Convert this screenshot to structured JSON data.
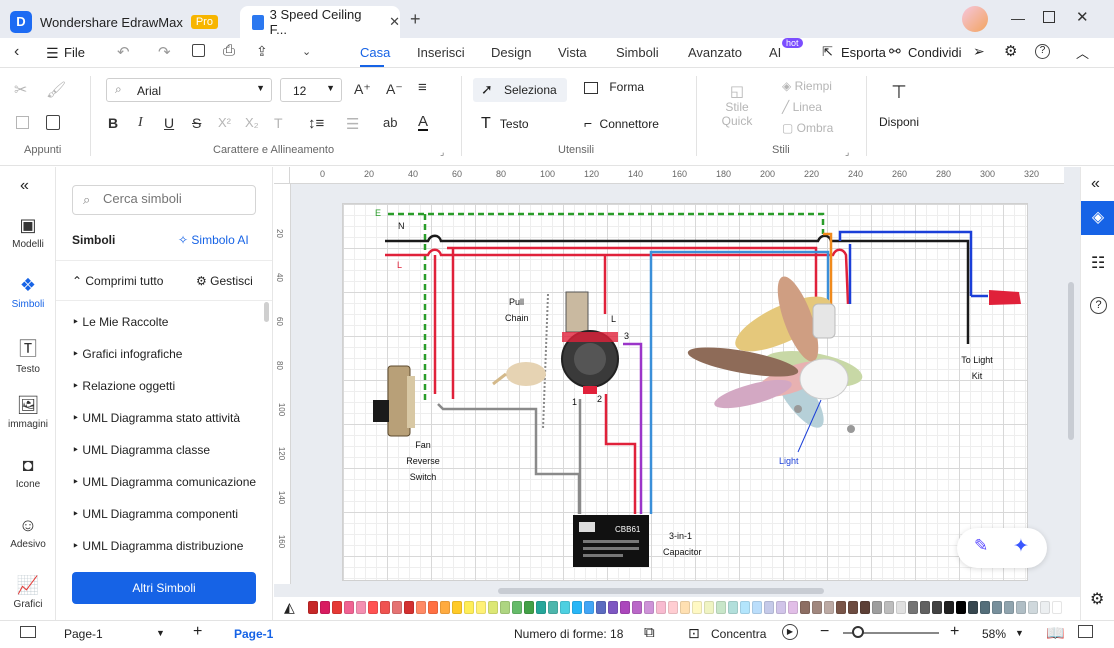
{
  "app": {
    "name": "Wondershare EdrawMax",
    "badge": "Pro",
    "doc_tab": "3 Speed Ceiling F..."
  },
  "menu": {
    "file": "File",
    "tabs": [
      "Casa",
      "Inserisci",
      "Design",
      "Vista",
      "Simboli",
      "Avanzato",
      "AI"
    ],
    "ai_badge": "hot",
    "export": "Esporta",
    "share": "Condividi"
  },
  "ribbon": {
    "font_name": "Arial",
    "font_size": "12",
    "select": "Seleziona",
    "shape": "Forma",
    "text": "Testo",
    "connector": "Connettore",
    "quick_style_1": "Stile",
    "quick_style_2": "Quick",
    "fill": "Riempi",
    "line": "Linea",
    "shadow": "Ombra",
    "arrange": "Disponi",
    "groups": [
      "Appunti",
      "Carattere e Allineamento",
      "Utensili",
      "Stili"
    ]
  },
  "rail": [
    "Modelli",
    "Simboli",
    "Testo",
    "immagini",
    "Icone",
    "Adesivo",
    "Grafici"
  ],
  "panel": {
    "search_placeholder": "Cerca simboli",
    "title": "Simboli",
    "ai_link": "Simbolo AI",
    "collapse": "Comprimi tutto",
    "manage": "Gestisci",
    "libraries": [
      "Le Mie Raccolte",
      "Grafici infografiche",
      "Relazione oggetti",
      "UML Diagramma stato attività",
      "UML Diagramma classe",
      "UML Diagramma comunicazione",
      "UML Diagramma componenti",
      "UML Diagramma distribuzione"
    ],
    "more_button": "Altri Simboli"
  },
  "ruler": {
    "h": [
      "0",
      "20",
      "40",
      "60",
      "80",
      "100",
      "120",
      "140",
      "160",
      "180",
      "200",
      "220",
      "240",
      "260",
      "280",
      "300",
      "320"
    ],
    "v": [
      "20",
      "40",
      "60",
      "80",
      "100",
      "120",
      "140",
      "160"
    ]
  },
  "diagram": {
    "labels": {
      "e": "E",
      "n": "N",
      "l": "L",
      "pull_1": "Pull",
      "pull_2": "Chain",
      "sw_l": "L",
      "sw_3": "3",
      "sw_1": "1",
      "sw_2": "2",
      "fan_1": "Fan",
      "fan_2": "Reverse",
      "fan_3": "Switch",
      "cap_1": "3-in-1",
      "cap_2": "Capacitor",
      "cap_brand": "CBB61",
      "light": "Light",
      "kit_1": "To Light",
      "kit_2": "Kit"
    },
    "colors": {
      "black": "#1a1a1a",
      "red": "#e0213a",
      "blue": "#1b3fd8",
      "green": "#2a9d2a",
      "orange": "#f08a1c",
      "purple": "#9b35c9",
      "gray": "#8a8a8a",
      "lightblue": "#3a8fd9"
    }
  },
  "status": {
    "page_select": "Page-1",
    "page_tab": "Page-1",
    "shapes_count": "Numero di forme: 18",
    "focus": "Concentra",
    "zoom": "58%"
  },
  "palette_colors": [
    "#c62828",
    "#d81b60",
    "#e53935",
    "#f06292",
    "#f48fb1",
    "#ff5252",
    "#ef5350",
    "#e57373",
    "#d32f2f",
    "#ff8a65",
    "#ff7043",
    "#ffab40",
    "#ffca28",
    "#ffee58",
    "#fff176",
    "#dce775",
    "#aed581",
    "#66bb6a",
    "#43a047",
    "#26a69a",
    "#4db6ac",
    "#4dd0e1",
    "#29b6f6",
    "#42a5f5",
    "#5c6bc0",
    "#7e57c2",
    "#ab47bc",
    "#ba68c8",
    "#ce93d8",
    "#f8bbd0",
    "#ffcdd2",
    "#ffe0b2",
    "#fff9c4",
    "#f0f4c3",
    "#c8e6c9",
    "#b2dfdb",
    "#b3e5fc",
    "#bbdefb",
    "#c5cae9",
    "#d1c4e9",
    "#e1bee7",
    "#8d6e63",
    "#a1887f",
    "#bcaaa4",
    "#795548",
    "#6d4c41",
    "#5d4037",
    "#9e9e9e",
    "#bdbdbd",
    "#e0e0e0",
    "#757575",
    "#616161",
    "#424242",
    "#212121",
    "#000000",
    "#37474f",
    "#546e7a",
    "#78909c",
    "#90a4ae",
    "#b0bec5",
    "#cfd8dc",
    "#eceff1",
    "#ffffff"
  ]
}
